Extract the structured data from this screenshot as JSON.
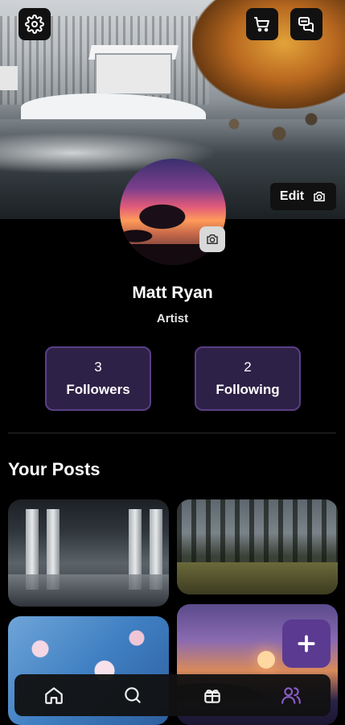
{
  "header": {
    "settings_icon": "gear-icon",
    "cart_icon": "cart-icon",
    "messages_icon": "chat-bubbles-icon",
    "edit_label": "Edit",
    "edit_icon": "camera-icon"
  },
  "profile": {
    "name": "Matt Ryan",
    "role": "Artist",
    "avatar_camera_icon": "camera-icon"
  },
  "stats": {
    "followers": {
      "count": "3",
      "label": "Followers"
    },
    "following": {
      "count": "2",
      "label": "Following"
    }
  },
  "posts": {
    "title": "Your Posts",
    "items": [
      "post-1",
      "post-2",
      "post-3",
      "post-4"
    ]
  },
  "fab": {
    "icon": "plus-icon"
  },
  "bottom_nav": {
    "items": [
      {
        "icon": "home-icon"
      },
      {
        "icon": "search-icon"
      },
      {
        "icon": "gift-box-icon"
      },
      {
        "icon": "users-icon",
        "active": true
      }
    ]
  },
  "colors": {
    "accent": "#5b3a91",
    "stat_bg": "#2e2147",
    "active_nav": "#8a5cc7",
    "background": "#000000"
  }
}
